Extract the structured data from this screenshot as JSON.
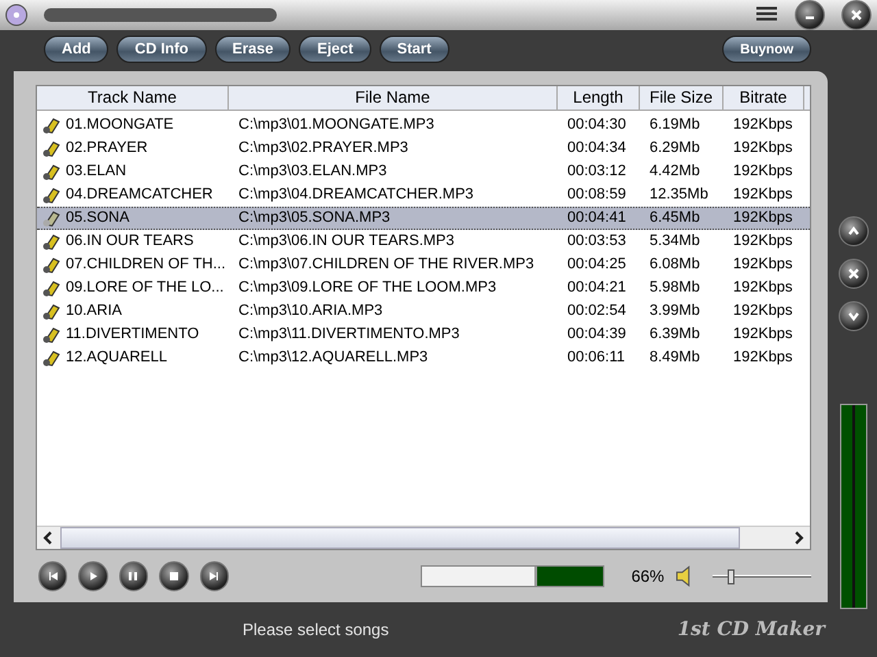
{
  "toolbar": [
    "Add",
    "CD Info",
    "Erase",
    "Eject",
    "Start"
  ],
  "buy_button": "Buynow",
  "table": {
    "columns": [
      "Track Name",
      "File Name",
      "Length",
      "File Size",
      "Bitrate"
    ],
    "rows": [
      {
        "cells": [
          "01.MOONGATE",
          "C:\\mp3\\01.MOONGATE.MP3",
          "00:04:30",
          "6.19Mb",
          "192Kbps"
        ],
        "selected": false
      },
      {
        "cells": [
          "02.PRAYER",
          "C:\\mp3\\02.PRAYER.MP3",
          "00:04:34",
          "6.29Mb",
          "192Kbps"
        ],
        "selected": false
      },
      {
        "cells": [
          "03.ELAN",
          "C:\\mp3\\03.ELAN.MP3",
          "00:03:12",
          "4.42Mb",
          "192Kbps"
        ],
        "selected": false
      },
      {
        "cells": [
          "04.DREAMCATCHER",
          "C:\\mp3\\04.DREAMCATCHER.MP3",
          "00:08:59",
          "12.35Mb",
          "192Kbps"
        ],
        "selected": false
      },
      {
        "cells": [
          "05.SONA",
          "C:\\mp3\\05.SONA.MP3",
          "00:04:41",
          "6.45Mb",
          "192Kbps"
        ],
        "selected": true
      },
      {
        "cells": [
          "06.IN OUR TEARS",
          "C:\\mp3\\06.IN OUR TEARS.MP3",
          "00:03:53",
          "5.34Mb",
          "192Kbps"
        ],
        "selected": false
      },
      {
        "cells": [
          "07.CHILDREN OF TH...",
          "C:\\mp3\\07.CHILDREN OF THE RIVER.MP3",
          "00:04:25",
          "6.08Mb",
          "192Kbps"
        ],
        "selected": false
      },
      {
        "cells": [
          "09.LORE OF THE LO...",
          "C:\\mp3\\09.LORE OF THE LOOM.MP3",
          "00:04:21",
          "5.98Mb",
          "192Kbps"
        ],
        "selected": false
      },
      {
        "cells": [
          "10.ARIA",
          "C:\\mp3\\10.ARIA.MP3",
          "00:02:54",
          "3.99Mb",
          "192Kbps"
        ],
        "selected": false
      },
      {
        "cells": [
          "11.DIVERTIMENTO",
          "C:\\mp3\\11.DIVERTIMENTO.MP3",
          "00:04:39",
          "6.39Mb",
          "192Kbps"
        ],
        "selected": false
      },
      {
        "cells": [
          "12.AQUARELL",
          "C:\\mp3\\12.AQUARELL.MP3",
          "00:06:11",
          "8.49Mb",
          "192Kbps"
        ],
        "selected": false
      }
    ]
  },
  "capacity": {
    "level": 0.64,
    "reading": "66%"
  },
  "volume": {
    "level": 0.15
  },
  "status": "Please select songs",
  "logo": "1st CD Maker"
}
